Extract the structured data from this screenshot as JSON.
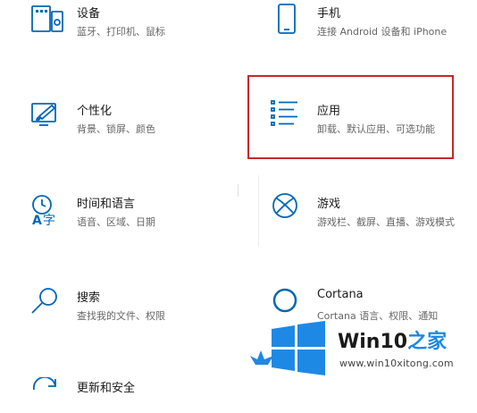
{
  "settings": {
    "items": [
      {
        "title": "设备",
        "subtitle": "蓝牙、打印机、鼠标",
        "icon": "keyboard-icon"
      },
      {
        "title": "手机",
        "subtitle": "连接 Android 设备和 iPhone",
        "icon": "phone-icon"
      },
      {
        "title": "个性化",
        "subtitle": "背景、锁屏、颜色",
        "icon": "paintbrush-icon"
      },
      {
        "title": "应用",
        "subtitle": "卸载、默认应用、可选功能",
        "icon": "apps-list-icon"
      },
      {
        "title": "时间和语言",
        "subtitle": "语音、区域、日期",
        "icon": "time-language-icon"
      },
      {
        "title": "游戏",
        "subtitle": "游戏栏、截屏、直播、游戏模式",
        "icon": "xbox-icon"
      },
      {
        "title": "搜索",
        "subtitle": "查找我的文件、权限",
        "icon": "search-icon"
      },
      {
        "title": "Cortana",
        "subtitle": "Cortana 语言、权限、通知",
        "icon": "cortana-icon"
      },
      {
        "title": "更新和安全",
        "subtitle": "",
        "icon": "update-icon"
      }
    ]
  },
  "highlight": {
    "target": "应用",
    "color": "#c62828"
  },
  "accent_color": "#0067b8",
  "watermark": {
    "brand_prefix": "Win10",
    "brand_suffix": "之家",
    "url": "www.win10xitong.com"
  }
}
